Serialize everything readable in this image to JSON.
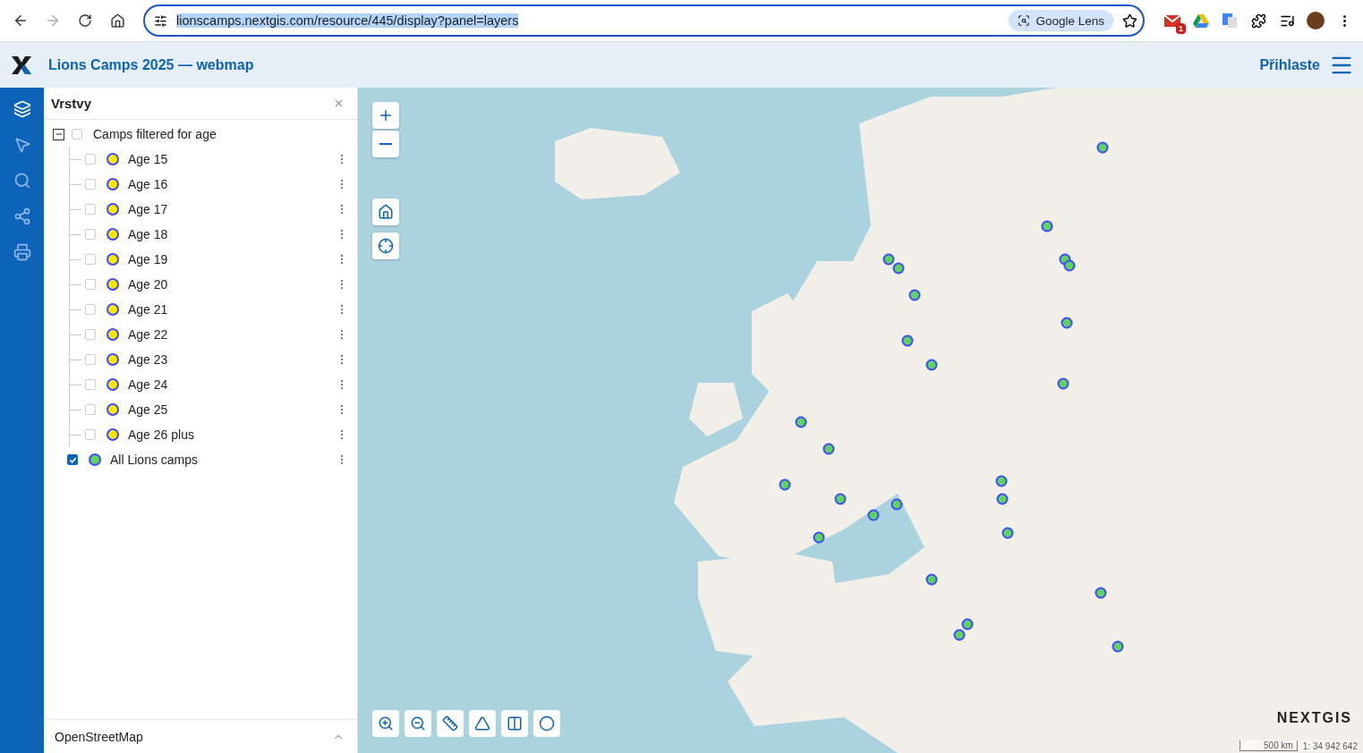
{
  "browser": {
    "url": "lionscamps.nextgis.com/resource/445/display?panel=layers",
    "lens_label": "Google Lens",
    "mail_badge": "1"
  },
  "header": {
    "title": "Lions Camps 2025 — webmap",
    "login": "Přihlaste"
  },
  "sidebar": {
    "items": [
      {
        "kind": "layers",
        "selected": true
      },
      {
        "kind": "select",
        "selected": false
      },
      {
        "kind": "search",
        "selected": false
      },
      {
        "kind": "share",
        "selected": false
      },
      {
        "kind": "print",
        "selected": false
      }
    ]
  },
  "panel": {
    "title": "Vrstvy",
    "layers": [
      {
        "label": "Camps filtered for age",
        "kind": "group",
        "checked": false,
        "expanded": true,
        "children": [
          {
            "label": "Age 15",
            "kind": "layer",
            "checked": false,
            "color": "#ffe600"
          },
          {
            "label": "Age 16",
            "kind": "layer",
            "checked": false,
            "color": "#ffe600"
          },
          {
            "label": "Age 17",
            "kind": "layer",
            "checked": false,
            "color": "#ffe600"
          },
          {
            "label": "Age 18",
            "kind": "layer",
            "checked": false,
            "color": "#ffe600"
          },
          {
            "label": "Age 19",
            "kind": "layer",
            "checked": false,
            "color": "#ffe600"
          },
          {
            "label": "Age 20",
            "kind": "layer",
            "checked": false,
            "color": "#ffe600"
          },
          {
            "label": "Age 21",
            "kind": "layer",
            "checked": false,
            "color": "#ffe600"
          },
          {
            "label": "Age 22",
            "kind": "layer",
            "checked": false,
            "color": "#ffe600"
          },
          {
            "label": "Age 23",
            "kind": "layer",
            "checked": false,
            "color": "#ffe600"
          },
          {
            "label": "Age 24",
            "kind": "layer",
            "checked": false,
            "color": "#ffe600"
          },
          {
            "label": "Age 25",
            "kind": "layer",
            "checked": false,
            "color": "#ffe600"
          },
          {
            "label": "Age 26 plus",
            "kind": "layer",
            "checked": false,
            "color": "#ffe600"
          }
        ]
      },
      {
        "label": "All Lions camps",
        "kind": "layer",
        "checked": true,
        "color": "#5fd35f"
      }
    ],
    "basemap": "OpenStreetMap"
  },
  "map": {
    "scale": "500 km",
    "ratio": "1: 34 942 642",
    "logo": "NEXTGIS"
  }
}
